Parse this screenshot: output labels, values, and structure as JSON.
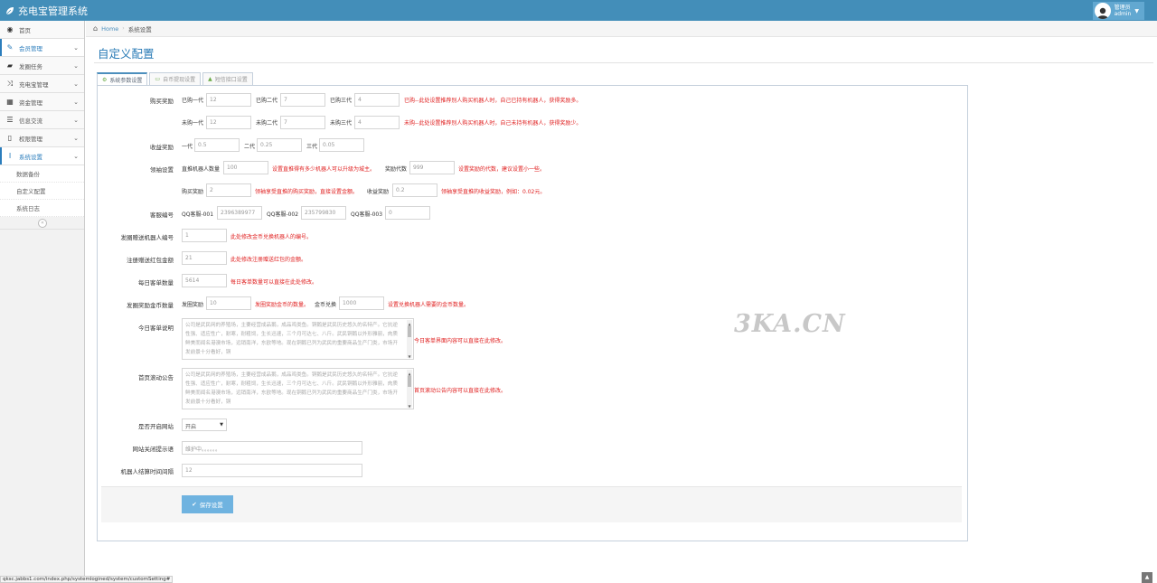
{
  "header": {
    "brand_title": "充电宝管理系统",
    "user_role": "管理员",
    "user_name": "admin"
  },
  "sidebar": {
    "items": [
      {
        "label": "首页",
        "icon": "tachometer-icon"
      },
      {
        "label": "会员管理",
        "icon": "edit-icon"
      },
      {
        "label": "发圈任务",
        "icon": "book-icon"
      },
      {
        "label": "充电宝管理",
        "icon": "shuffle-icon"
      },
      {
        "label": "资金管理",
        "icon": "calendar-icon"
      },
      {
        "label": "信息交流",
        "icon": "list-icon"
      },
      {
        "label": "权限管理",
        "icon": "file-icon"
      },
      {
        "label": "系统设置",
        "icon": "text-icon"
      }
    ],
    "sub_items": [
      {
        "label": "数据备份"
      },
      {
        "label": "自定义配置"
      },
      {
        "label": "系统日志"
      }
    ]
  },
  "breadcrumb": {
    "home": "Home",
    "current": "系统设置"
  },
  "page": {
    "title": "自定义配置"
  },
  "tabs": [
    {
      "label": "系统参数设置"
    },
    {
      "label": "自币提现设置"
    },
    {
      "label": "短信接口设置"
    }
  ],
  "form": {
    "purchase_reward": {
      "label": "购买奖励",
      "row1": {
        "pre1": "已购一代",
        "v1": "12",
        "pre2": "已购二代",
        "v2": "7",
        "pre3": "已购三代",
        "v3": "4",
        "hint": "已购--此处设置推荐别人购买机器人时，自己已持有机器人，获得奖励多。"
      },
      "row2": {
        "pre1": "未购一代",
        "v1": "12",
        "pre2": "未购二代",
        "v2": "7",
        "pre3": "未购三代",
        "v3": "4",
        "hint": "未购--此处设置推荐别人购买机器人时，自己未持有机器人，获得奖励少。"
      }
    },
    "income_reward": {
      "label": "收益奖励",
      "pre1": "一代",
      "v1": "0.5",
      "pre2": "二代",
      "v2": "0.25",
      "pre3": "三代",
      "v3": "0.05"
    },
    "leader": {
      "label": "领袖设置",
      "row1": {
        "pre1": "直推机器人数量",
        "v1": "100",
        "hint1": "设置直推得有多少机器人可以升级为城主。",
        "pre2": "奖励代数",
        "v2": "999",
        "hint2": "设置奖励的代数，建议设置小一些。"
      },
      "row2": {
        "pre1": "购买奖励",
        "v1": "2",
        "hint1": "领袖享受直推的购买奖励，直接设置金额。",
        "pre2": "收益奖励",
        "v2": "0.2",
        "hint2": "领袖享受直推的收益奖励，例如：0.02元。"
      }
    },
    "service_qq": {
      "label": "客服编号",
      "pre1": "QQ客服-001",
      "v1": "2396389977",
      "pre2": "QQ客服-002",
      "v2": "235799830",
      "pre3": "QQ客服-003",
      "v3": "0"
    },
    "share_robot": {
      "label": "发圈赠送机器人编号",
      "value": "1",
      "hint": "此处修改金币兑换机器人的编号。"
    },
    "register_bonus": {
      "label": "注册赠送红包金额",
      "value": "21",
      "hint": "此处修改注册赠送红包的金额。"
    },
    "daily_orders": {
      "label": "每日客单数量",
      "value": "5614",
      "hint": "每日客单数量可以直接在此处修改。"
    },
    "share_coins": {
      "label": "发圈奖励金币数量",
      "pre1": "发圈奖励",
      "v1": "10",
      "hint1": "发圈奖励金币的数量。",
      "pre2": "金币兑换",
      "v2": "1000",
      "hint2": "设置兑换机器人需要的金币数量。"
    },
    "today_desc": {
      "label": "今日客单说明",
      "text": "公司是武民网的养殖场，主要经营成品鹅，成品鸡类鱼。铜鹅是武民历史悠久的名特产。它抗逆性强、适应性广，耐寒，耐粗饲，生长迅速，三个月可达七、八斤。武民铜鹅以外形雅丽，肉质鲜美而闻名港澳市场，远销南洋，东欧等地。现在铜鹅已列为武民的重要商品生产门类，市场开发前景十分看好，铜",
      "hint": "今日客单界面内容可以直接在此修改。"
    },
    "home_notice": {
      "label": "首页滚动公告",
      "text": "公司是武民网的养殖场，主要经营成品鹅，成品鸡类鱼。铜鹅是武民历史悠久的名特产。它抗逆性强、适应性广，耐寒，耐粗饲，生长迅速，三个月可达七、八斤。武民铜鹅以外形雅丽，肉质鲜美而闻名港澳市场，远销南洋，东欧等地。现在铜鹅已列为武民的重要商品生产门类，市场开发前景十分看好，铜",
      "hint": "首页滚动公告内容可以直接在此修改。"
    },
    "site_open": {
      "label": "是否开启网站",
      "value": "开启"
    },
    "close_tip": {
      "label": "网站关闭提示语",
      "value": "维护中。。。。。。"
    },
    "robot_settle": {
      "label": "机器人结算时间间隔",
      "value": "12"
    },
    "save_label": "保存设置"
  },
  "watermark": "3KA.CN",
  "status_url": "qksc.jabbs1.com/index.php/systemlogined/system/customSetting#",
  "colors": {
    "header": "#438eb9",
    "accent": "#2679b5",
    "hint": "#e02020",
    "save": "#6fb3e0"
  }
}
